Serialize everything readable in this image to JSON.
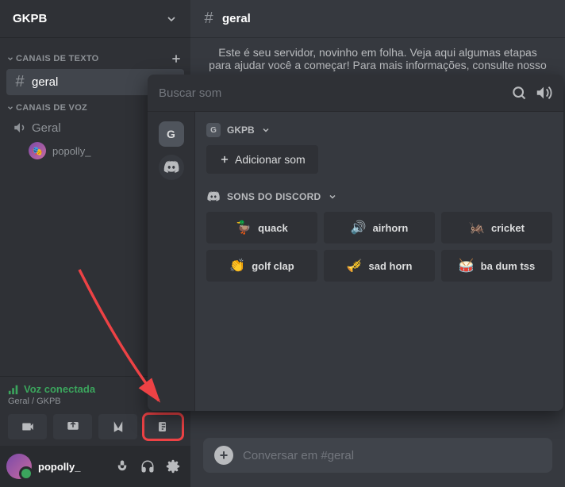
{
  "server": {
    "name": "GKPB"
  },
  "sidebar": {
    "text_heading": "CANAIS DE TEXTO",
    "voice_heading": "CANAIS DE VOZ",
    "text_channels": [
      {
        "name": "geral"
      }
    ],
    "voice_channels": [
      {
        "name": "Geral",
        "members": [
          {
            "name": "popolly_"
          }
        ]
      }
    ]
  },
  "voice_panel": {
    "status": "Voz conectada",
    "sub": "Geral / GKPB"
  },
  "user": {
    "name": "popolly_"
  },
  "channel_header": {
    "name": "geral"
  },
  "welcome_line": "Este é seu servidor, novinho em folha. Veja aqui algumas etapas para ajudar você a começar! Para mais informações, consulte nosso Guia de Introdução.",
  "soundboard": {
    "search_placeholder": "Buscar som",
    "server_label": "GKPB",
    "add_sound": "Adicionar som",
    "discord_sounds_heading": "SONS DO DISCORD",
    "server_letter": "G",
    "sounds": [
      {
        "emoji": "🦆",
        "label": "quack"
      },
      {
        "emoji": "🔊",
        "label": "airhorn"
      },
      {
        "emoji": "🦗",
        "label": "cricket"
      },
      {
        "emoji": "👏",
        "label": "golf clap"
      },
      {
        "emoji": "🎺",
        "label": "sad horn"
      },
      {
        "emoji": "🥁",
        "label": "ba dum tss"
      }
    ]
  },
  "compose": {
    "placeholder": "Conversar em #geral"
  }
}
